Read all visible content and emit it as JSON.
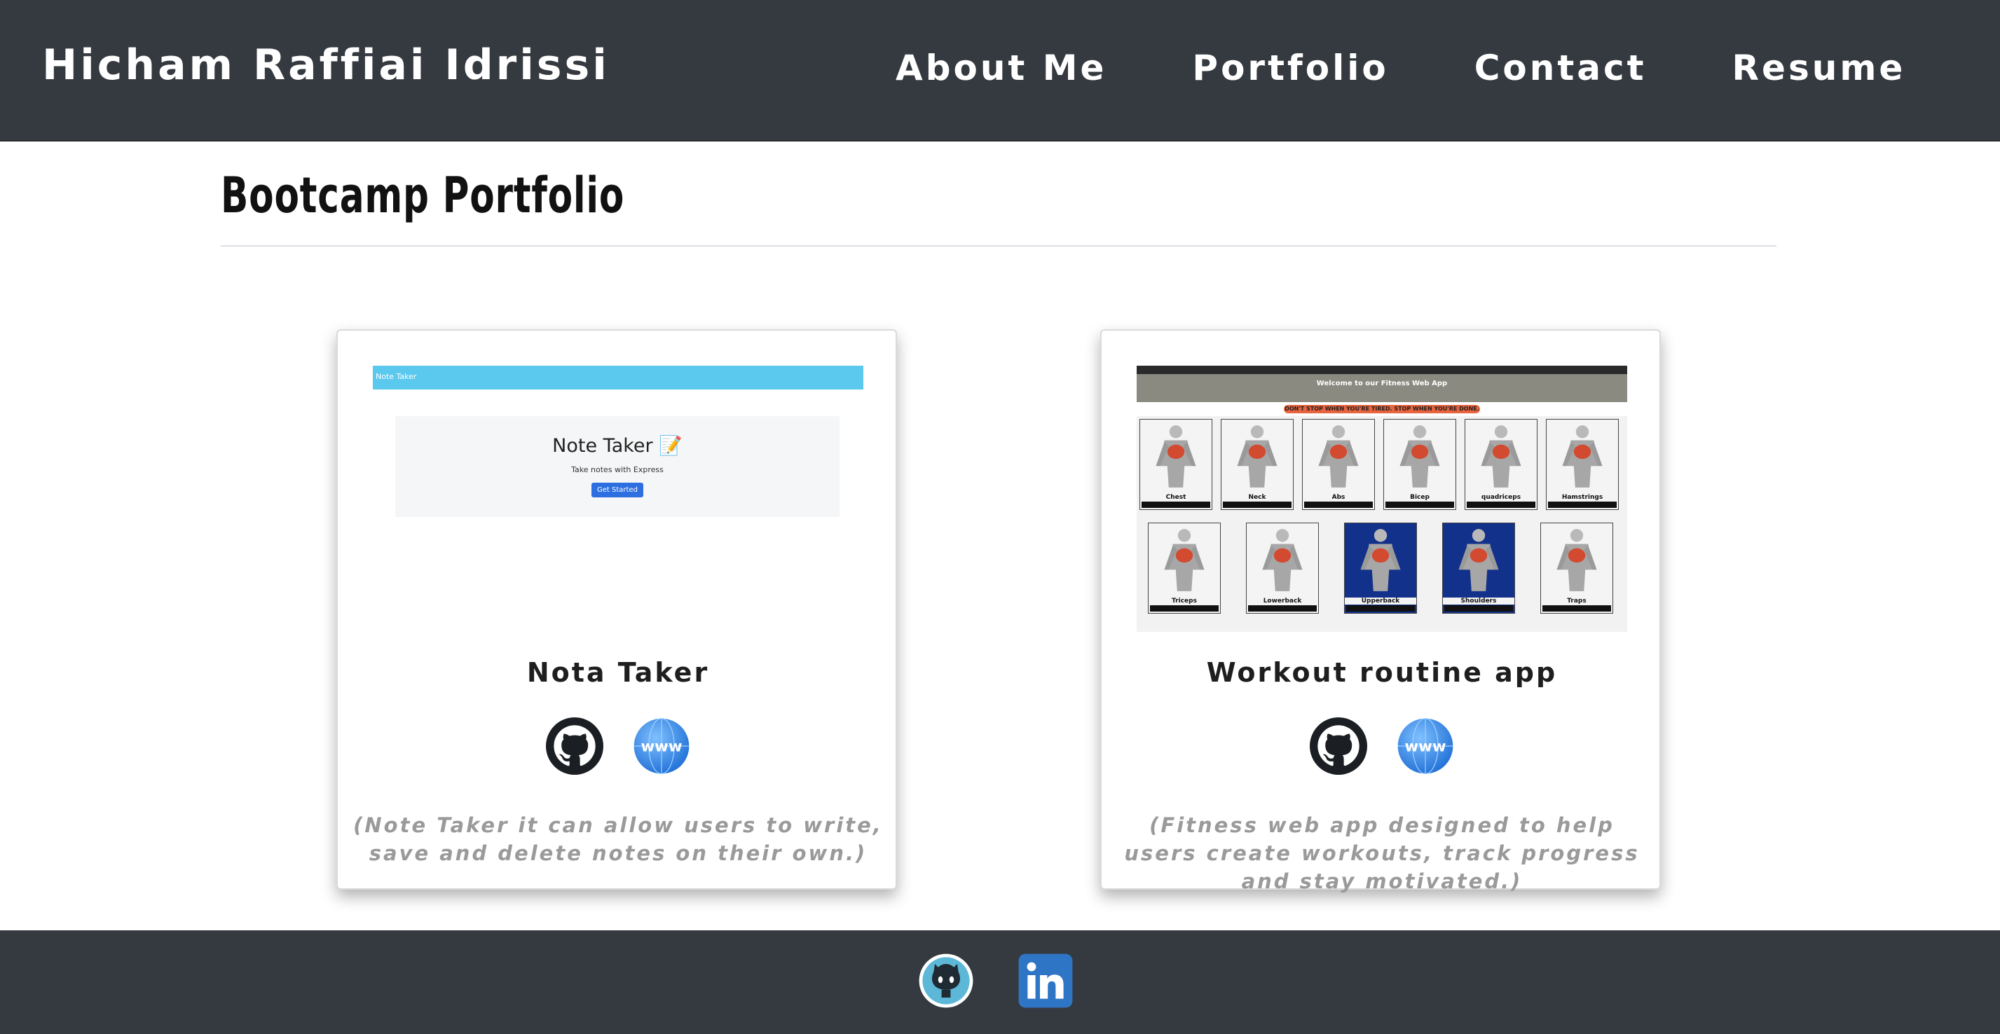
{
  "header": {
    "brand": "Hicham Raffiai Idrissi",
    "nav": [
      {
        "label": "About Me"
      },
      {
        "label": "Portfolio"
      },
      {
        "label": "Contact"
      },
      {
        "label": "Resume"
      }
    ]
  },
  "section": {
    "title": "Bootcamp Portfolio"
  },
  "projects": [
    {
      "title": "Nota Taker",
      "description": "(Note Taker it can allow users to write, save and delete notes on their own.)",
      "icons": [
        "github-icon",
        "www-globe-icon"
      ],
      "screenshot": {
        "navbar_label": "Note Taker",
        "heading": "Note Taker 📝",
        "subheading": "Take notes with Express",
        "button": "Get Started"
      }
    },
    {
      "title": "Workout routine app",
      "description": "(Fitness web app designed to help users create workouts, track progress and stay motivated.)",
      "icons": [
        "github-icon",
        "www-globe-icon"
      ],
      "screenshot": {
        "welcome": "Welcome to our Fitness Web App",
        "banner": "DON'T STOP WHEN YOU'RE TIRED. STOP WHEN YOU'RE DONE.",
        "muscles_row1": [
          "Chest",
          "Neck",
          "Abs",
          "Bicep",
          "quadriceps",
          "Hamstrings"
        ],
        "muscles_row2": [
          "Triceps",
          "Lowerback",
          "Upperback",
          "Shoulders",
          "Traps"
        ]
      }
    }
  ],
  "footer": {
    "icons": [
      "github-octocat-icon",
      "linkedin-icon"
    ]
  },
  "colors": {
    "header_bg": "#343a40",
    "footer_bg": "#343a40",
    "text_muted": "#9a9a9a",
    "globe_blue": "#3b8be8",
    "linkedin_blue": "#2f75c5"
  }
}
